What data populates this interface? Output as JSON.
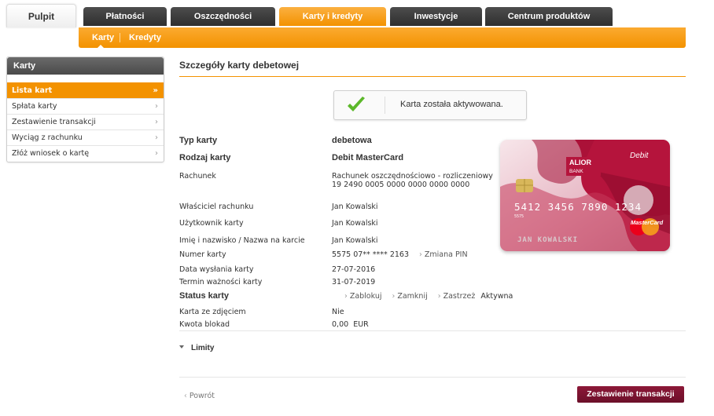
{
  "colors": {
    "accent": "#f39200",
    "dark_tab": "#3a3a3a",
    "primary_button": "#7a1230",
    "card_bg": "#b5143c"
  },
  "top_tabs": [
    {
      "label": "Pulpit",
      "active": false
    },
    {
      "label": "Płatności",
      "active": false
    },
    {
      "label": "Oszczędności",
      "active": false
    },
    {
      "label": "Karty i kredyty",
      "active": true
    },
    {
      "label": "Inwestycje",
      "active": false
    },
    {
      "label": "Centrum produktów",
      "active": false
    }
  ],
  "sub_nav": {
    "items": [
      "Karty",
      "Kredyty"
    ],
    "active": "Karty"
  },
  "sidebar": {
    "title": "Karty",
    "items": [
      {
        "label": "Lista kart",
        "active": true,
        "chevron": "»"
      },
      {
        "label": "Spłata karty",
        "active": false,
        "chevron": "›"
      },
      {
        "label": "Zestawienie transakcji",
        "active": false,
        "chevron": "›"
      },
      {
        "label": "Wyciąg z rachunku",
        "active": false,
        "chevron": "›"
      },
      {
        "label": "Złóż wniosek o kartę",
        "active": false,
        "chevron": "›"
      }
    ]
  },
  "main": {
    "title": "Szczegóły karty debetowej",
    "notice": {
      "icon": "checkmark-icon",
      "message": "Karta została aktywowana."
    },
    "details": {
      "typ_karty": {
        "label": "Typ karty",
        "value": "debetowa"
      },
      "rodzaj_karty": {
        "label": "Rodzaj karty",
        "value": "Debit MasterCard"
      },
      "rachunek": {
        "label": "Rachunek",
        "value_line1": "Rachunek oszczędnościowo - rozliczeniowy",
        "value_line2": "19 2490 0005 0000 0000 0000 0000"
      },
      "wlasciciel": {
        "label": "Właściciel rachunku",
        "value": "Jan Kowalski"
      },
      "uzytkownik": {
        "label": "Użytkownik karty",
        "value": "Jan Kowalski"
      },
      "imie": {
        "label": "Imię i nazwisko / Nazwa na karcie",
        "value": "Jan Kowalski"
      },
      "numer": {
        "label": "Numer karty",
        "value": "5575 07** **** 2163",
        "link": "Zmiana PIN"
      },
      "data_wyslania": {
        "label": "Data wysłania karty",
        "value": "27-07-2016"
      },
      "termin": {
        "label": "Termin ważności karty",
        "value": "31-07-2019"
      },
      "status": {
        "label": "Status karty",
        "actions": [
          "Zablokuj",
          "Zamknij",
          "Zastrzeż"
        ],
        "value": "Aktywna"
      },
      "zdjecie": {
        "label": "Karta ze zdjęciem",
        "value": "Nie"
      },
      "blokady": {
        "label": "Kwota blokad",
        "value": "0,00  EUR"
      }
    },
    "card_image": {
      "brand": "ALIOR",
      "brand_sub": "BANK",
      "product": "Debit",
      "pan": "5412 3456 7890 1234",
      "pan_small": "5575",
      "holder": "JAN KOWALSKI",
      "network": "MasterCard"
    },
    "limity": "Limity",
    "back": "Powrót",
    "report_button": "Zestawienie transakcji"
  }
}
